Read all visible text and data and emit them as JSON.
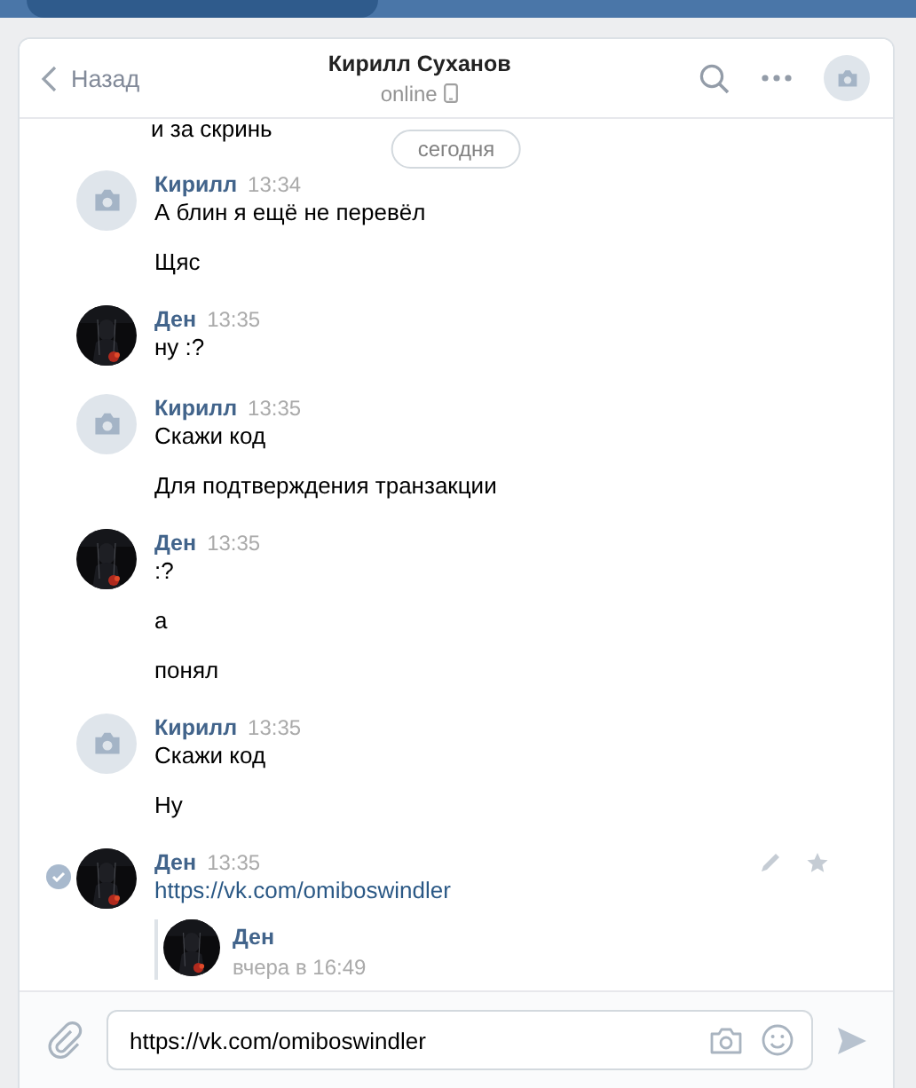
{
  "header": {
    "back": "Назад",
    "title": "Кирилл Суханов",
    "status": "online"
  },
  "date_divider": "сегодня",
  "cut_text": "и за скринь",
  "groups": [
    {
      "sender": "Кирилл",
      "time": "13:34",
      "avatar": {
        "kind": "camera"
      },
      "selected": false,
      "messages": [
        {
          "kind": "text",
          "text": "А блин я ещё не перевёл"
        },
        {
          "kind": "text",
          "text": "Щяс"
        }
      ]
    },
    {
      "sender": "Ден",
      "time": "13:35",
      "avatar": {
        "kind": "picture"
      },
      "selected": false,
      "messages": [
        {
          "kind": "text",
          "text": "ну :?"
        }
      ]
    },
    {
      "sender": "Кирилл",
      "time": "13:35",
      "avatar": {
        "kind": "camera"
      },
      "selected": false,
      "messages": [
        {
          "kind": "text",
          "text": "Скажи код"
        },
        {
          "kind": "text",
          "text": "Для подтверждения транзакции"
        }
      ]
    },
    {
      "sender": "Ден",
      "time": "13:35",
      "avatar": {
        "kind": "picture"
      },
      "selected": false,
      "messages": [
        {
          "kind": "text",
          "text": ":?"
        },
        {
          "kind": "text",
          "text": "а"
        },
        {
          "kind": "text",
          "text": "понял"
        }
      ]
    },
    {
      "sender": "Кирилл",
      "time": "13:35",
      "avatar": {
        "kind": "camera"
      },
      "selected": false,
      "messages": [
        {
          "kind": "text",
          "text": "Скажи код"
        },
        {
          "kind": "text",
          "text": "Ну"
        }
      ]
    },
    {
      "sender": "Ден",
      "time": "13:35",
      "avatar": {
        "kind": "picture"
      },
      "selected": true,
      "messages": [
        {
          "kind": "link",
          "text": "https://vk.com/omiboswindler"
        },
        {
          "kind": "forward",
          "sender": "Ден",
          "time": "вчера в 16:49",
          "avatar": {
            "kind": "picture"
          }
        }
      ]
    }
  ],
  "composer": {
    "value": "https://vk.com/omiboswindler"
  }
}
